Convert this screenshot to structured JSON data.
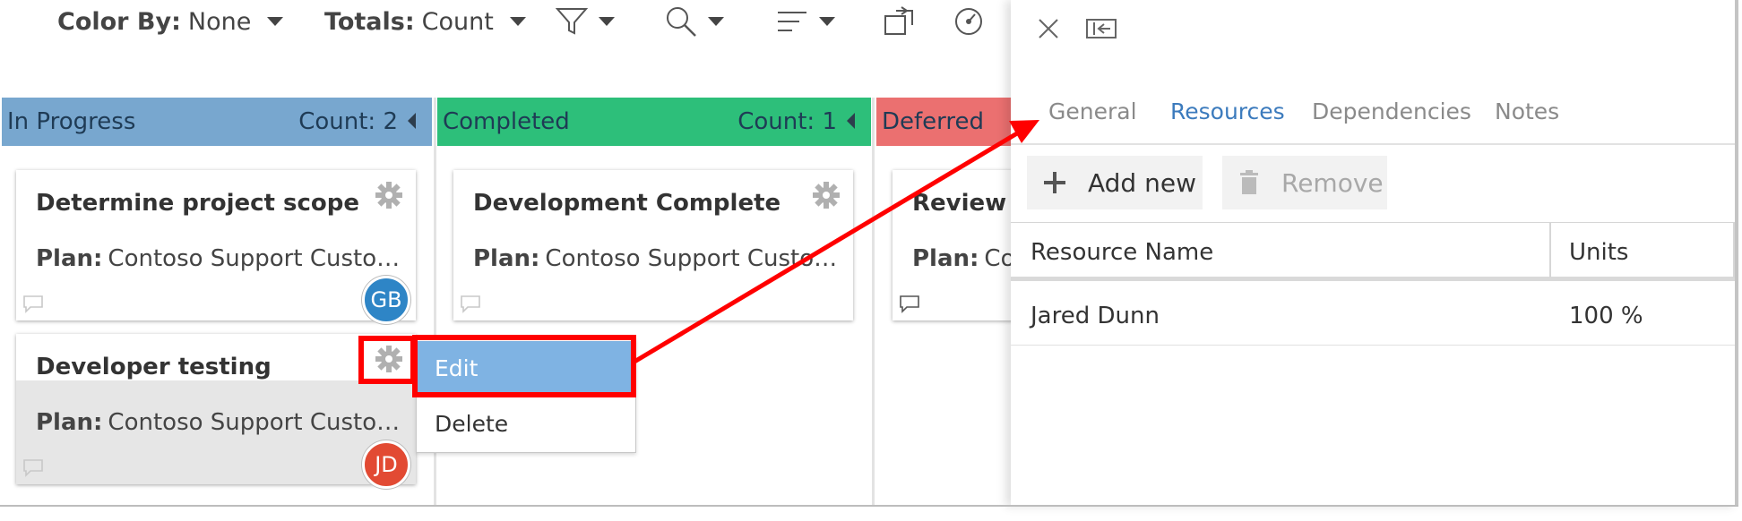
{
  "toolbar": {
    "color_by_label": "Color By:",
    "color_by_value": "None",
    "totals_label": "Totals:",
    "totals_value": "Count",
    "icons": [
      "filter-icon",
      "search-icon",
      "sort-icon",
      "export-icon",
      "dashboard-icon"
    ]
  },
  "columns": [
    {
      "title": "In Progress",
      "count": "Count: 2",
      "color": "#78a7cf",
      "cards": [
        {
          "title": "Determine project scope",
          "plan_label": "Plan:",
          "plan": "Contoso Support Custom...",
          "avatar": "GB",
          "avatar_color": "#2e85c6"
        },
        {
          "title": "Developer testing",
          "plan_label": "Plan:",
          "plan": "Contoso Support Custom...",
          "avatar": "JD",
          "avatar_color": "#e24a33"
        }
      ]
    },
    {
      "title": "Completed",
      "count": "Count: 1",
      "color": "#2dbf7a",
      "cards": [
        {
          "title": "Development Complete",
          "plan_label": "Plan:",
          "plan": "Contoso Support Custom..."
        }
      ]
    },
    {
      "title": "Deferred",
      "color": "#eb7070",
      "cards": [
        {
          "title": "Review f",
          "plan_label": "Plan:",
          "plan": "Con"
        }
      ]
    }
  ],
  "context_menu": {
    "items": [
      "Edit",
      "Delete"
    ],
    "highlight_color": "#7fb3e3"
  },
  "panel": {
    "tabs": [
      "General",
      "Resources",
      "Dependencies",
      "Notes"
    ],
    "active_tab": "Resources",
    "add_label": "Add new",
    "remove_label": "Remove",
    "grid": {
      "headers": [
        "Resource Name",
        "Units"
      ],
      "rows": [
        {
          "name": "Jared Dunn",
          "units": "100 %"
        }
      ]
    }
  },
  "annotation_color": "#ff0000"
}
